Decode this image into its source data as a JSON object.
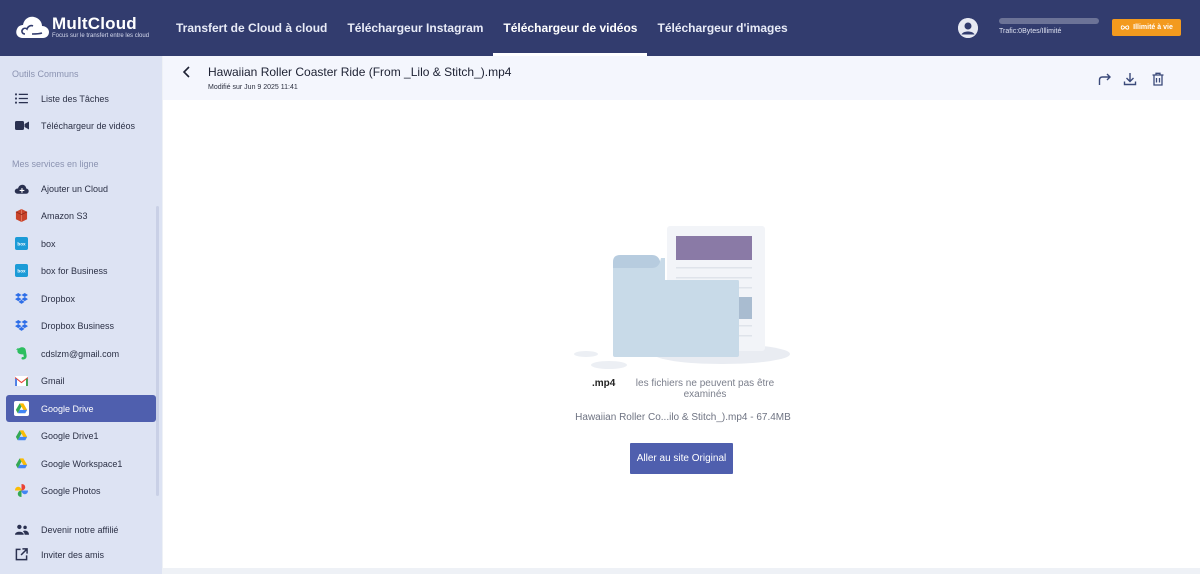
{
  "app": {
    "name": "MultCloud",
    "tagline": "Focus sur le transfert entre les cloud"
  },
  "nav": {
    "items": [
      {
        "label": "Transfert de Cloud à cloud",
        "active": false
      },
      {
        "label": "Téléchargeur Instagram",
        "active": false
      },
      {
        "label": "Téléchargeur de vidéos",
        "active": true
      },
      {
        "label": "Téléchargeur d'images",
        "active": false
      }
    ]
  },
  "account": {
    "avatar_icon": "user-avatar-icon",
    "traffic_text": "Trafic:0Bytes/Illimité",
    "upgrade_label": "Illimité à vie",
    "upgrade_color": "#f39a1e"
  },
  "sidebar": {
    "section_common": "Outils Communs",
    "common_items": [
      {
        "label": "Liste des Tâches",
        "icon": "list-icon"
      },
      {
        "label": "Téléchargeur de vidéos",
        "icon": "video-camera-icon"
      }
    ],
    "section_services": "Mes services en ligne",
    "service_items": [
      {
        "label": "Ajouter un Cloud",
        "icon": "cloud-add-icon",
        "active": false
      },
      {
        "label": "Amazon S3",
        "icon": "amazon-s3-icon",
        "active": false
      },
      {
        "label": "box",
        "icon": "box-icon",
        "active": false
      },
      {
        "label": "box for Business",
        "icon": "box-business-icon",
        "active": false
      },
      {
        "label": "Dropbox",
        "icon": "dropbox-icon",
        "active": false
      },
      {
        "label": "Dropbox Business",
        "icon": "dropbox-business-icon",
        "active": false
      },
      {
        "label": "cdslzm@gmail.com",
        "icon": "evernote-icon",
        "active": false
      },
      {
        "label": "Gmail",
        "icon": "gmail-icon",
        "active": false
      },
      {
        "label": "Google Drive",
        "icon": "google-drive-icon",
        "active": true
      },
      {
        "label": "Google Drive1",
        "icon": "google-drive-icon",
        "active": false
      },
      {
        "label": "Google Workspace1",
        "icon": "google-drive-icon",
        "active": false
      },
      {
        "label": "Google Photos",
        "icon": "google-photos-icon",
        "active": false
      }
    ],
    "bottom_items": [
      {
        "label": "Devenir notre affilié",
        "icon": "people-icon"
      },
      {
        "label": "Inviter des amis",
        "icon": "share-out-icon"
      }
    ]
  },
  "file": {
    "title": "Hawaiian Roller Coaster Ride (From _Lilo & Stitch_).mp4",
    "modified": "Modifié sur Jun 9 2025 11:41",
    "extension": ".mp4",
    "preview_message": "les fichiers ne peuvent pas être examinés",
    "info": "Hawaiian Roller Co...ilo & Stitch_).mp4 - 67.4MB",
    "open_original_label": "Aller au site Original"
  },
  "header_actions": [
    "share-icon",
    "download-icon",
    "delete-icon"
  ],
  "colors": {
    "navbar": "#323c6e",
    "sidebar": "#dde3f3",
    "accent": "#4f5fae"
  }
}
